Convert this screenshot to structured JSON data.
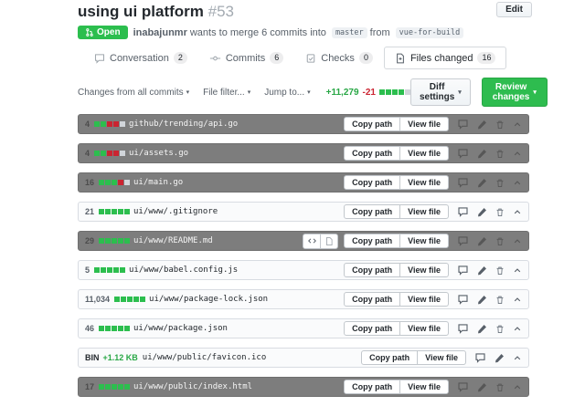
{
  "header": {
    "title": "using ui platform",
    "pr_number": "#53",
    "edit_label": "Edit",
    "state_badge": "Open",
    "author": "inabajunmr",
    "merge_text_pre": "wants to merge",
    "commits_in_sentence": "6",
    "merge_text_mid": "commits into",
    "base_branch": "master",
    "from_text": "from",
    "head_branch": "vue-for-build"
  },
  "tabs": [
    {
      "label": "Conversation",
      "count": "2"
    },
    {
      "label": "Commits",
      "count": "6"
    },
    {
      "label": "Checks",
      "count": "0"
    },
    {
      "label": "Files changed",
      "count": "16"
    }
  ],
  "toolbar": {
    "changes_dropdown": "Changes from all commits",
    "file_filter": "File filter...",
    "jump_to": "Jump to...",
    "additions": "+11,279",
    "deletions": "-21",
    "blocks": "GGGGN",
    "diff_settings": "Diff settings",
    "review_changes": "Review changes"
  },
  "file_actions": {
    "copy_path": "Copy path",
    "view_file": "View file"
  },
  "colors": {
    "accent_green": "#2cbe4e",
    "addition_green": "#28a745",
    "deletion_red": "#cb2431",
    "dark_row_bg": "#7d7d7d"
  },
  "files": [
    {
      "stat": "4",
      "blocks": "GGRRN",
      "path": "github/trending/api.go"
    },
    {
      "stat": "4",
      "blocks": "GGRRN",
      "path": "ui/assets.go"
    },
    {
      "stat": "16",
      "blocks": "GGGRN",
      "path": "ui/main.go"
    },
    {
      "stat": "21",
      "blocks": "GGGGG",
      "path": "ui/www/.gitignore"
    },
    {
      "stat": "29",
      "blocks": "GGGGG",
      "path": "ui/www/README.md"
    },
    {
      "stat": "5",
      "blocks": "GGGGG",
      "path": "ui/www/babel.config.js"
    },
    {
      "stat": "11,034",
      "blocks": "GGGGG",
      "path": "ui/www/package-lock.json"
    },
    {
      "stat": "46",
      "blocks": "GGGGG",
      "path": "ui/www/package.json"
    },
    {
      "stat_bin": "BIN",
      "size": "+1.12 KB",
      "path": "ui/www/public/favicon.ico"
    },
    {
      "stat": "17",
      "blocks": "GGGGG",
      "path": "ui/www/public/index.html"
    }
  ]
}
